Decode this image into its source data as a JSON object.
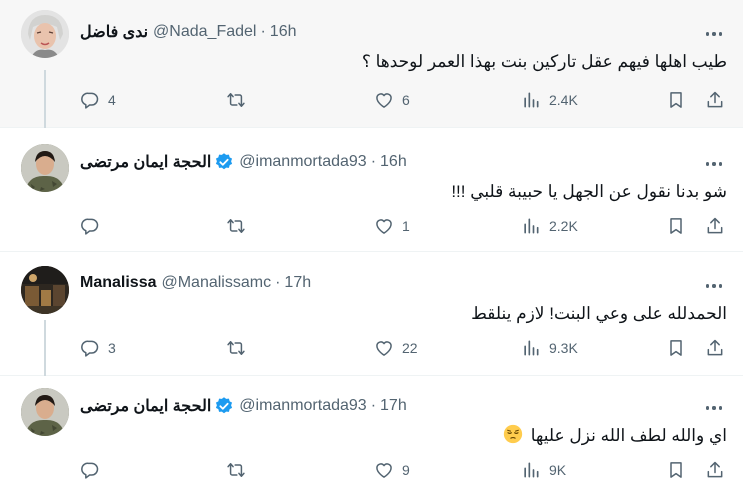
{
  "tweets": [
    {
      "name": "ندى فاضل",
      "handle": "@Nada_Fadel",
      "time": "16h",
      "text": "طيب اهلها فيهم عقل تاركين بنت بهذا العمر لوحدها ؟",
      "verified": false,
      "replies": "4",
      "reposts": "",
      "likes": "6",
      "views": "2.4K"
    },
    {
      "name": "الحجة ايمان مرتضى",
      "handle": "@imanmortada93",
      "time": "16h",
      "text": "شو بدنا نقول عن الجهل يا حبيبة قلبي !!!",
      "verified": true,
      "replies": "",
      "reposts": "",
      "likes": "1",
      "views": "2.2K"
    },
    {
      "name": "Manalissa",
      "handle": "@Manalissamc",
      "time": "17h",
      "text": "الحمدلله على وعي البنت! لازم ينلقط",
      "verified": false,
      "replies": "3",
      "reposts": "",
      "likes": "22",
      "views": "9.3K"
    },
    {
      "name": "الحجة ايمان مرتضى",
      "handle": "@imanmortada93",
      "time": "17h",
      "text": "اي والله لطف الله نزل عليها",
      "emoji": "pensive-face-emoji",
      "verified": true,
      "replies": "",
      "reposts": "",
      "likes": "9",
      "views": "9K"
    }
  ],
  "icons": {
    "reply": "reply-icon",
    "repost": "repost-icon",
    "like": "like-icon",
    "views": "views-icon",
    "bookmark": "bookmark-icon",
    "share": "share-icon",
    "more": "more-icon",
    "verified": "verified-badge-icon"
  },
  "colors": {
    "text": "#0f1419",
    "secondary": "#536471",
    "verified": "#1d9bf0",
    "thread_line": "#cfd9de",
    "highlight_bg": "#f7f7f7"
  },
  "misc": {
    "dot": "·"
  }
}
